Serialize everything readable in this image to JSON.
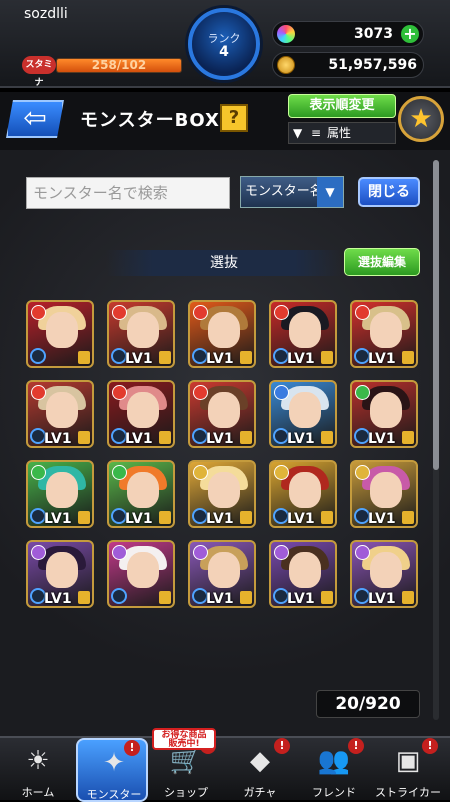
{
  "user": {
    "name": "sozdlli"
  },
  "stamina": {
    "label": "スタミナ",
    "text": "258/102",
    "fill_fraction": 1.0
  },
  "rank": {
    "label": "ランク",
    "value": "4"
  },
  "orbs": {
    "value": "3073",
    "add_label": "+"
  },
  "coins": {
    "value": "51,957,596"
  },
  "header": {
    "back_label": "⇦",
    "title": "モンスターBOX",
    "help_label": "?",
    "sort_label": "表示順変更",
    "attr_label": "属性",
    "fav_label": "★"
  },
  "search": {
    "placeholder": "モンスター名で検索",
    "mode": "モンスター名",
    "caret": "▼",
    "close_label": "閉じる"
  },
  "selection": {
    "label": "選抜",
    "edit_label": "選抜編集"
  },
  "count": "20/920",
  "monsters": [
    {
      "lv": "",
      "element": "#e23b2e",
      "hair": "#f0d19a",
      "bg": "#b9202a"
    },
    {
      "lv": "LV1",
      "element": "#e23b2e",
      "hair": "#d9b98a",
      "bg": "#c73a2e"
    },
    {
      "lv": "LV1",
      "element": "#e23b2e",
      "hair": "#b07a3a",
      "bg": "#e25a1a"
    },
    {
      "lv": "LV1",
      "element": "#e23b2e",
      "hair": "#1a1a22",
      "bg": "#c82a28"
    },
    {
      "lv": "LV1",
      "element": "#e23b2e",
      "hair": "#d8c08a",
      "bg": "#d4302c"
    },
    {
      "lv": "LV1",
      "element": "#e23b2e",
      "hair": "#d8c4a0",
      "bg": "#b53a30"
    },
    {
      "lv": "LV1",
      "element": "#e23b2e",
      "hair": "#e08a8a",
      "bg": "#8a1a1e"
    },
    {
      "lv": "LV1",
      "element": "#e23b2e",
      "hair": "#6a4028",
      "bg": "#cc3a30"
    },
    {
      "lv": "LV1",
      "element": "#3a7be0",
      "hair": "#d8e4ef",
      "bg": "#3a8ad6"
    },
    {
      "lv": "LV1",
      "element": "#3ab84a",
      "hair": "#2a1416",
      "bg": "#b8302c"
    },
    {
      "lv": "LV1",
      "element": "#3ab84a",
      "hair": "#2fb7a5",
      "bg": "#48b24a"
    },
    {
      "lv": "LV1",
      "element": "#3ab84a",
      "hair": "#f07a2a",
      "bg": "#5ab84a"
    },
    {
      "lv": "LV1",
      "element": "#e0b43a",
      "hair": "#f4dc9a",
      "bg": "#e0a838"
    },
    {
      "lv": "LV1",
      "element": "#e0b43a",
      "hair": "#b0281e",
      "bg": "#d8a430"
    },
    {
      "lv": "LV1",
      "element": "#e0b43a",
      "hair": "#c85aa8",
      "bg": "#c79a3a"
    },
    {
      "lv": "LV1",
      "element": "#a05cd8",
      "hair": "#2a1a3a",
      "bg": "#7a4aa8"
    },
    {
      "lv": "",
      "element": "#a05cd8",
      "hair": "#f4f0f0",
      "bg": "#c23a8a"
    },
    {
      "lv": "LV1",
      "element": "#a05cd8",
      "hair": "#c8a05a",
      "bg": "#8a58b8"
    },
    {
      "lv": "LV1",
      "element": "#a05cd8",
      "hair": "#4a3020",
      "bg": "#7a4ab0"
    },
    {
      "lv": "LV1",
      "element": "#a05cd8",
      "hair": "#f0d08a",
      "bg": "#8a54b4"
    }
  ],
  "nav": [
    {
      "label": "ホーム",
      "icon": "☀",
      "name": "home"
    },
    {
      "label": "モンスター",
      "icon": "✦",
      "name": "monster",
      "active": true,
      "badge": "!"
    },
    {
      "label": "ショップ",
      "icon": "🛒",
      "name": "shop",
      "badge": "!"
    },
    {
      "label": "ガチャ",
      "icon": "◆",
      "name": "gacha",
      "badge": "!"
    },
    {
      "label": "フレンド",
      "icon": "👥",
      "name": "friend",
      "badge": "!"
    },
    {
      "label": "ストライカー",
      "icon": "▣",
      "name": "striker",
      "badge": "!"
    }
  ],
  "promo": {
    "line1": "お得な商品",
    "line2": "販売中!"
  }
}
